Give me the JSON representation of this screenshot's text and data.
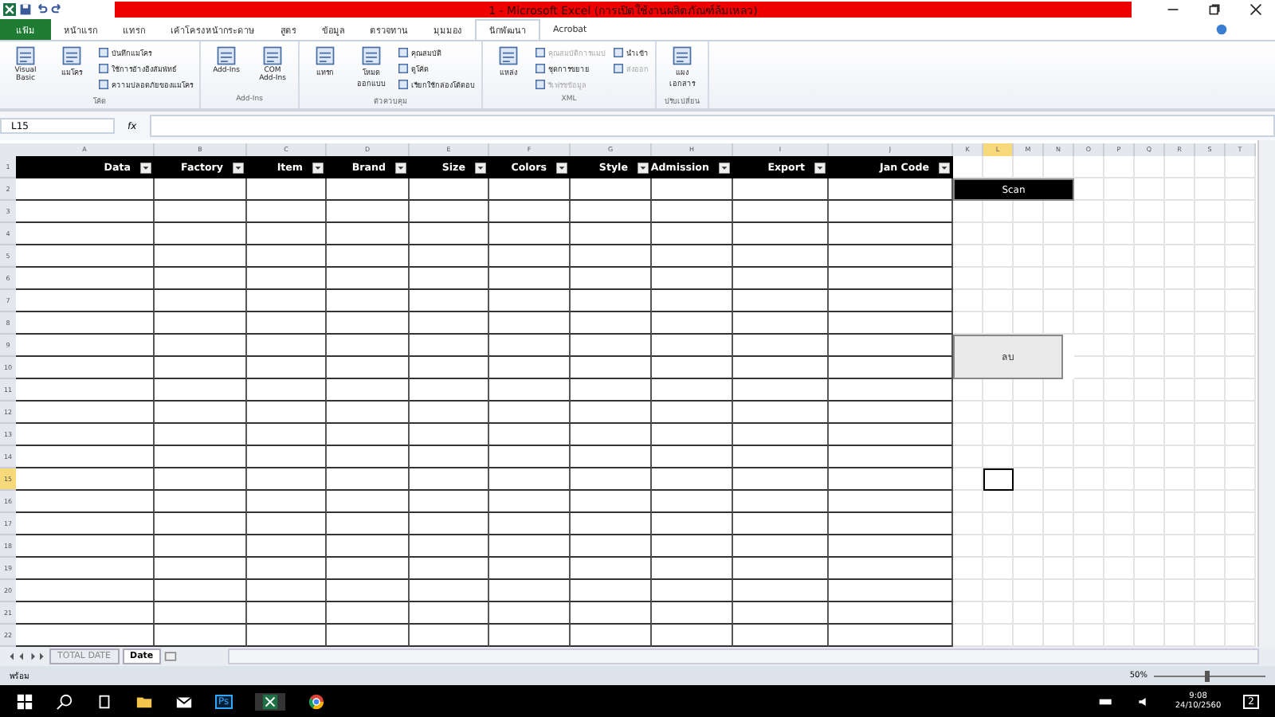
{
  "window": {
    "title": "1 - Microsoft Excel (การเปิดใช้งานผลิตภัณฑ์ล้มเหลว)"
  },
  "ribbon_tabs": [
    {
      "label": "แฟ้ม",
      "selected": false,
      "kind": "file"
    },
    {
      "label": "หน้าแรก",
      "selected": false,
      "kind": "tab"
    },
    {
      "label": "แทรก",
      "selected": false,
      "kind": "tab"
    },
    {
      "label": "เค้าโครงหน้ากระดาษ",
      "selected": false,
      "kind": "tab"
    },
    {
      "label": "สูตร",
      "selected": false,
      "kind": "tab"
    },
    {
      "label": "ข้อมูล",
      "selected": false,
      "kind": "tab"
    },
    {
      "label": "ตรวจทาน",
      "selected": false,
      "kind": "tab"
    },
    {
      "label": "มุมมอง",
      "selected": false,
      "kind": "tab"
    },
    {
      "label": "นักพัฒนา",
      "selected": true,
      "kind": "tab"
    },
    {
      "label": "Acrobat",
      "selected": false,
      "kind": "tab"
    }
  ],
  "ribbon_groups": [
    {
      "label": "โค้ด",
      "items": [
        {
          "label": "Visual Basic",
          "kind": "large",
          "disabled": false
        },
        {
          "label": "แมโคร",
          "kind": "large",
          "disabled": false
        },
        {
          "label": "บันทึกแมโคร",
          "kind": "small",
          "disabled": false
        },
        {
          "label": "ใช้การอ้างอิงสัมพัทธ์",
          "kind": "small",
          "disabled": false
        },
        {
          "label": "ความปลอดภัยของแมโคร",
          "kind": "small",
          "disabled": false
        }
      ]
    },
    {
      "label": "Add-Ins",
      "items": [
        {
          "label": "Add-Ins",
          "kind": "large",
          "disabled": false
        },
        {
          "label": "COM Add-Ins",
          "kind": "large",
          "disabled": false
        }
      ]
    },
    {
      "label": "ตัวควบคุม",
      "items": [
        {
          "label": "แทรก",
          "kind": "large",
          "disabled": false
        },
        {
          "label": "โหมดออกแบบ",
          "kind": "large",
          "disabled": false
        },
        {
          "label": "คุณสมบัติ",
          "kind": "small",
          "disabled": false
        },
        {
          "label": "ดูโค้ด",
          "kind": "small",
          "disabled": false
        },
        {
          "label": "เรียกใช้กล่องโต้ตอบ",
          "kind": "small",
          "disabled": false
        }
      ]
    },
    {
      "label": "XML",
      "items": [
        {
          "label": "แหล่ง",
          "kind": "large",
          "disabled": false
        },
        {
          "label": "คุณสมบัติการแมป",
          "kind": "small",
          "disabled": true
        },
        {
          "label": "ชุดการขยาย",
          "kind": "small",
          "disabled": false
        },
        {
          "label": "รีเฟรชข้อมูล",
          "kind": "small",
          "disabled": true
        },
        {
          "label": "นำเข้า",
          "kind": "small",
          "disabled": false
        },
        {
          "label": "ส่งออก",
          "kind": "small",
          "disabled": true
        }
      ]
    },
    {
      "label": "ปรับเปลี่ยน",
      "items": [
        {
          "label": "แผงเอกสาร",
          "kind": "large",
          "disabled": false
        }
      ]
    }
  ],
  "name_box": {
    "value": "L15"
  },
  "formula_bar": {
    "label": "fx"
  },
  "column_letters": [
    "A",
    "B",
    "C",
    "D",
    "E",
    "F",
    "G",
    "H",
    "I",
    "J",
    "K",
    "L",
    "M",
    "N",
    "O",
    "P",
    "Q",
    "R",
    "S",
    "T"
  ],
  "row_numbers": [
    "1",
    "2",
    "3",
    "4",
    "5",
    "6",
    "7",
    "8",
    "9",
    "10",
    "11",
    "12",
    "13",
    "14",
    "15",
    "16",
    "17",
    "18",
    "19",
    "20",
    "21",
    "22"
  ],
  "table": {
    "columns": [
      "Data",
      "Factory",
      "Item",
      "Brand",
      "Size",
      "Colors",
      "Style",
      "Admission",
      "Export",
      "Jan Code"
    ]
  },
  "sheet_buttons": [
    {
      "label": "Scan",
      "kind": "dark"
    },
    {
      "label": "ลบ",
      "kind": "light"
    }
  ],
  "sheet_tabs": [
    {
      "label": "TOTAL DATE",
      "selected": false
    },
    {
      "label": "Date",
      "selected": true
    }
  ],
  "status_bar": {
    "status": "พร้อม",
    "zoom": "50%",
    "zoom_slider": {
      "level": 0.45
    }
  },
  "taskbar": {
    "ps_label": "Ps",
    "time": "9:08",
    "date": "24/10/2560",
    "notifications": "2"
  }
}
